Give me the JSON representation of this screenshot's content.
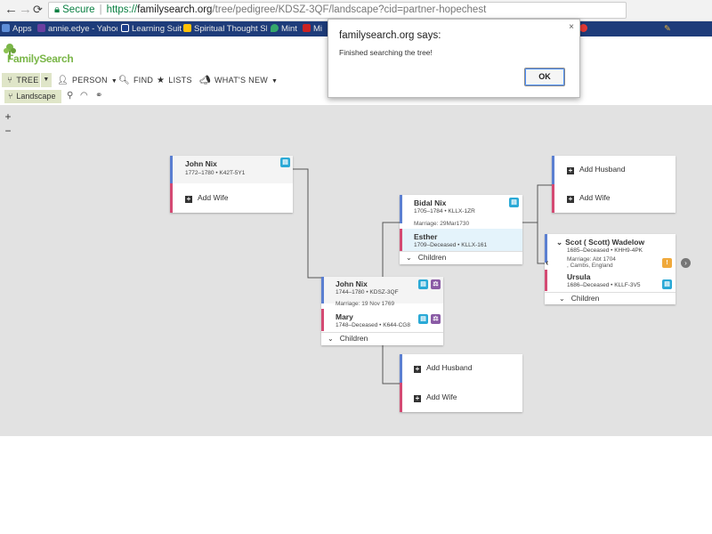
{
  "browser": {
    "back": "←",
    "forward": "→",
    "reload": "⟳",
    "secure_label": "Secure",
    "url_scheme": "https://",
    "url_host": "familysearch.org",
    "url_path": "/tree/pedigree/KDSZ-3QF/landscape?cid=partner-hopechest",
    "bookmarks": [
      {
        "label": "Apps",
        "color": "#5f8ed8"
      },
      {
        "label": "annie.edye - Yahoo M",
        "color": "#6b3fa0"
      },
      {
        "label": "Learning Suite",
        "color": "#1b3d8a"
      },
      {
        "label": "Spiritual Thought Sh",
        "color": "#ffc107"
      },
      {
        "label": "Mint",
        "color": "#35a86b"
      },
      {
        "label": "Mi",
        "color": "#cc2222"
      }
    ]
  },
  "fs": {
    "logo_text": "FamilySearch",
    "nav": {
      "tree": "TREE",
      "person": "PERSON",
      "find": "FIND",
      "lists": "LISTS",
      "whats_new": "WHAT'S NEW"
    },
    "view_landscape": "Landscape"
  },
  "dialog": {
    "title": "familysearch.org says:",
    "message": "Finished searching the tree!",
    "ok": "OK",
    "close": "×"
  },
  "tree": {
    "zoom_in": "+",
    "zoom_out": "−",
    "gen0": {
      "father": {
        "name": "John Nix",
        "meta": "1772–1780 • K42T-5Y1"
      },
      "add_wife": "Add Wife"
    },
    "focus": {
      "husband": {
        "name": "John Nix",
        "meta": "1744–1780 • KDSZ-3QF"
      },
      "marriage": "Marriage: 19 Nov 1769",
      "wife": {
        "name": "Mary",
        "meta": "1748–Deceased • K644-CG8"
      },
      "children": "Children"
    },
    "parents": {
      "husband": {
        "name": "Bidal Nix",
        "meta": "1705–1784 • KLLX-1ZR"
      },
      "marriage": "Marriage: 29Mar1730",
      "wife": {
        "name": "Esther",
        "meta": "1709–Deceased • KLLX-161"
      },
      "children": "Children"
    },
    "empty_mother_parents": {
      "add_husband": "Add Husband",
      "add_wife": "Add Wife"
    },
    "grandparents_empty": {
      "add_husband": "Add Husband",
      "add_wife": "Add Wife"
    },
    "grandparents": {
      "husband": {
        "name": "Scot ( Scott) Wadelow",
        "meta": "1685–Deceased • KHH9-4PK"
      },
      "marriage_line1": "Marriage: Abt 1704",
      "marriage_line2": ", Cambs, England",
      "wife": {
        "name": "Ursula",
        "meta": "1686–Deceased • KLLF-3V5"
      },
      "children": "Children"
    }
  }
}
